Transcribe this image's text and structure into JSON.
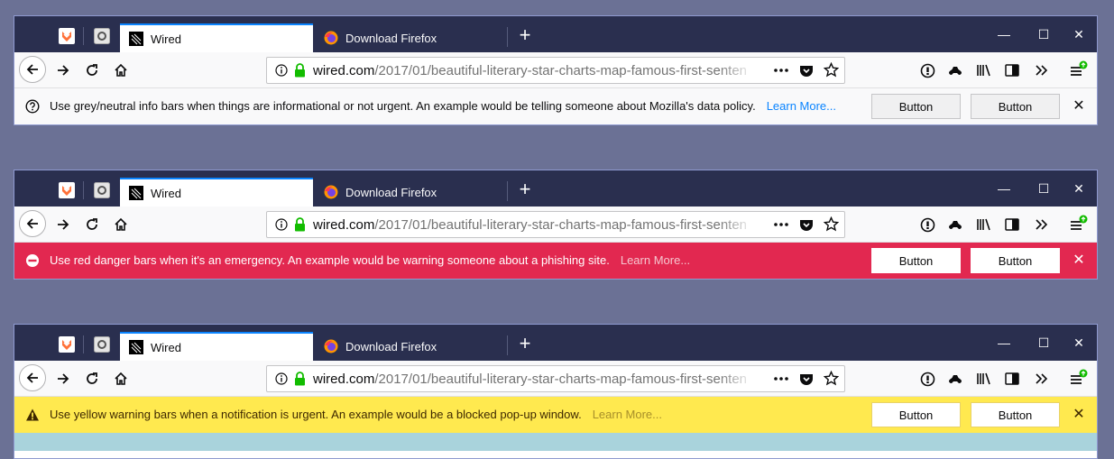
{
  "windows": [
    {
      "variant": "info",
      "tabs": [
        {
          "label": "Wired",
          "active": true
        },
        {
          "label": "Download Firefox",
          "active": false
        }
      ],
      "url": {
        "domain": "wired.com",
        "path": "/2017/01/beautiful-literary-star-charts-map-famous-first-senten"
      },
      "infobar": {
        "message": "Use grey/neutral info bars when things are informational or not urgent. An example would be telling someone about Mozilla's data policy.",
        "learn_more": "Learn More...",
        "button1": "Button",
        "button2": "Button",
        "icon": "question-circle-icon",
        "color": "#f9f9fa"
      }
    },
    {
      "variant": "danger",
      "tabs": [
        {
          "label": "Wired",
          "active": true
        },
        {
          "label": "Download Firefox",
          "active": false
        }
      ],
      "url": {
        "domain": "wired.com",
        "path": "/2017/01/beautiful-literary-star-charts-map-famous-first-senten"
      },
      "infobar": {
        "message": "Use red danger bars when it's an emergency. An example would be warning someone about a phishing site.",
        "learn_more": "Learn More...",
        "button1": "Button",
        "button2": "Button",
        "icon": "block-icon",
        "color": "#e22850"
      }
    },
    {
      "variant": "warning",
      "tabs": [
        {
          "label": "Wired",
          "active": true
        },
        {
          "label": "Download Firefox",
          "active": false
        }
      ],
      "url": {
        "domain": "wired.com",
        "path": "/2017/01/beautiful-literary-star-charts-map-famous-first-senten"
      },
      "infobar": {
        "message": "Use yellow warning bars when a notification is urgent. An example would be a blocked pop-up window.",
        "learn_more": "Learn More...",
        "button1": "Button",
        "button2": "Button",
        "icon": "warning-triangle-icon",
        "color": "#ffe94f"
      }
    }
  ],
  "colors": {
    "titlebar": "#2a2f4f",
    "accent": "#0a84ff",
    "background": "#6b7195",
    "secure_lock": "#12bc00"
  }
}
